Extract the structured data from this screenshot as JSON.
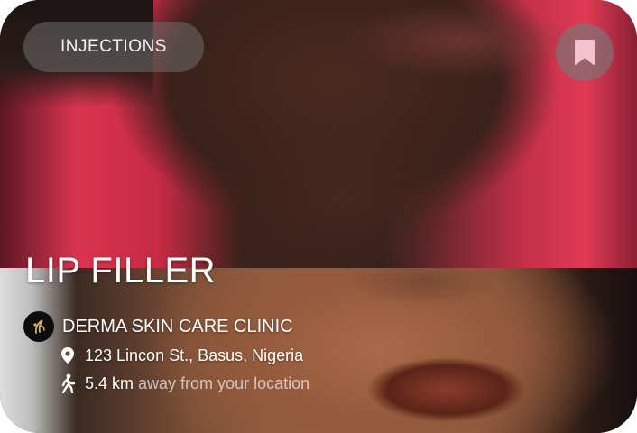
{
  "card": {
    "category_chip": "INJECTIONS",
    "bookmark_icon": "bookmark-icon",
    "title": "LIP FILLER",
    "clinic": {
      "logo_icon": "clinic-logo-icon",
      "name": "DERMA SKIN CARE CLINIC"
    },
    "address": {
      "icon": "location-pin-icon",
      "text": "123 Lincon St., Basus, Nigeria"
    },
    "distance": {
      "icon": "walking-person-icon",
      "value": "5.4 km",
      "suffix": "away from your location"
    }
  },
  "colors": {
    "bookmark": "#f4c2cf",
    "chip_background": "#6e6e6e",
    "text": "#ffffff"
  }
}
